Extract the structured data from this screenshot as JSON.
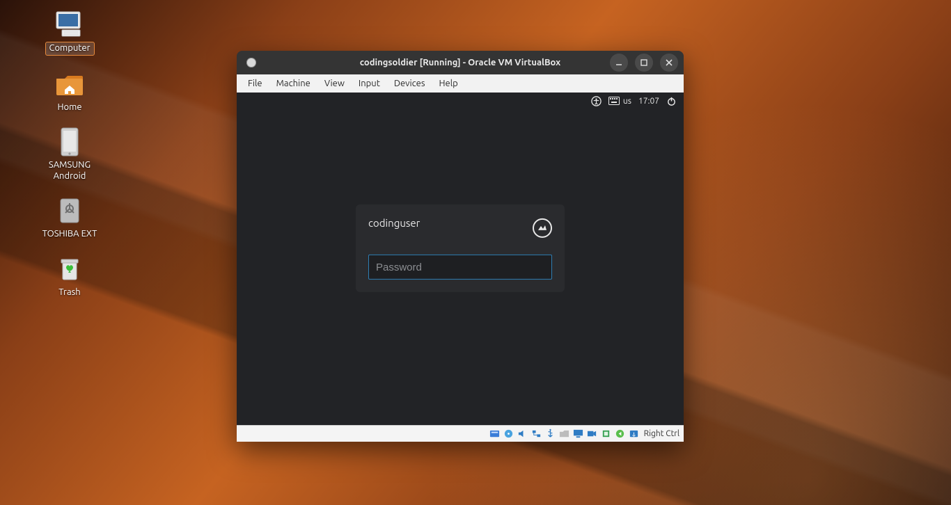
{
  "desktop": {
    "icons": [
      {
        "id": "computer",
        "label": "Computer",
        "selected": true
      },
      {
        "id": "home",
        "label": "Home"
      },
      {
        "id": "samsung",
        "label": "SAMSUNG Android"
      },
      {
        "id": "toshiba",
        "label": "TOSHIBA EXT"
      },
      {
        "id": "trash",
        "label": "Trash"
      }
    ]
  },
  "vb": {
    "title": "codingsoldier [Running] - Oracle VM VirtualBox",
    "menu": [
      "File",
      "Machine",
      "View",
      "Input",
      "Devices",
      "Help"
    ],
    "hostkey": "Right Ctrl"
  },
  "guest": {
    "topbar": {
      "kb_layout": "us",
      "time": "17:07"
    },
    "login": {
      "username": "codinguser",
      "password_placeholder": "Password"
    }
  }
}
